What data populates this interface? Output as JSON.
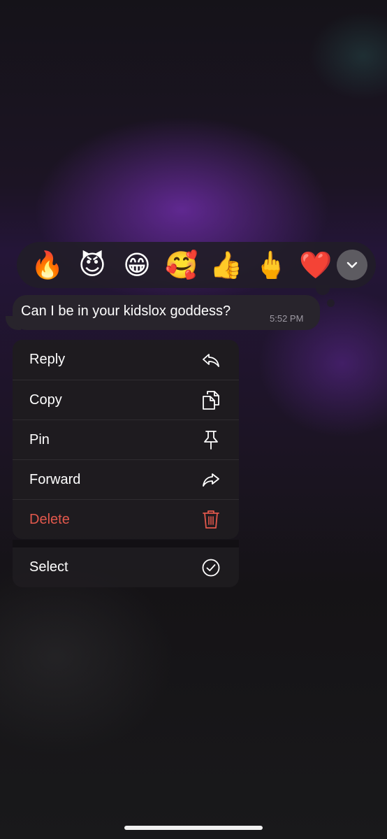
{
  "reactions": [
    {
      "emoji": "🔥",
      "name": "fire"
    },
    {
      "emoji": "😈",
      "name": "smiling-devil"
    },
    {
      "emoji": "😁",
      "name": "beaming-face"
    },
    {
      "emoji": "🥰",
      "name": "smiling-face-with-hearts"
    },
    {
      "emoji": "👍",
      "name": "thumbs-up"
    },
    {
      "emoji": "🖕",
      "name": "middle-finger"
    },
    {
      "emoji": "❤️",
      "name": "red-heart"
    }
  ],
  "expand_icon": "chevron-down-icon",
  "message": {
    "text": "Can I be in your kidslox goddess?",
    "time": "5:52 PM"
  },
  "menu": {
    "reply": {
      "label": "Reply",
      "icon": "reply-icon"
    },
    "copy": {
      "label": "Copy",
      "icon": "copy-icon"
    },
    "pin": {
      "label": "Pin",
      "icon": "pin-icon"
    },
    "forward": {
      "label": "Forward",
      "icon": "forward-icon"
    },
    "delete": {
      "label": "Delete",
      "icon": "trash-icon"
    },
    "select": {
      "label": "Select",
      "icon": "checkmark-circle-icon"
    }
  },
  "colors": {
    "danger": "#e2584c",
    "bubble": "#28242c",
    "menu_background": "#1e1c1f"
  }
}
